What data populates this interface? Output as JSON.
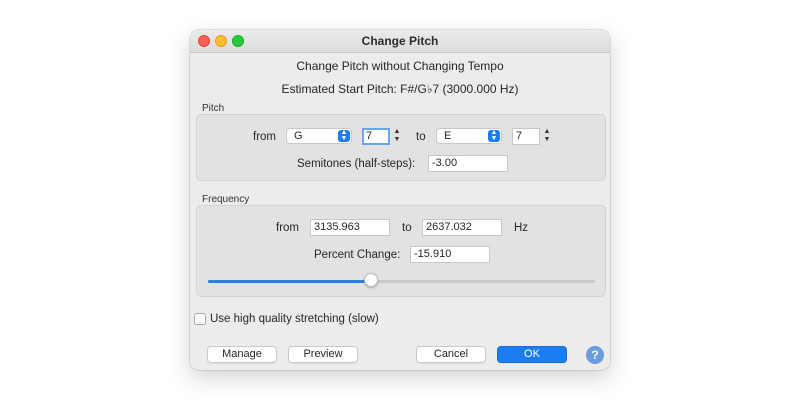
{
  "window": {
    "title": "Change Pitch"
  },
  "header": {
    "subtitle": "Change Pitch without Changing Tempo",
    "estimated_pitch": "Estimated Start Pitch: F#/G♭7 (3000.000 Hz)"
  },
  "pitch": {
    "section_label": "Pitch",
    "from_label": "from",
    "from_note": "G",
    "from_octave": "7",
    "to_label": "to",
    "to_note": "E",
    "to_octave": "7",
    "semitones_label": "Semitones (half-steps):",
    "semitones_value": "-3.00"
  },
  "frequency": {
    "section_label": "Frequency",
    "from_label": "from",
    "from_value": "3135.963",
    "to_label": "to",
    "to_value": "2637.032",
    "unit": "Hz",
    "percent_label": "Percent Change:",
    "percent_value": "-15.910",
    "slider_fraction": 0.42
  },
  "options": {
    "high_quality_label": "Use high quality stretching (slow)",
    "high_quality_checked": false
  },
  "buttons": {
    "manage": "Manage",
    "preview": "Preview",
    "cancel": "Cancel",
    "ok": "OK",
    "help": "?"
  },
  "colors": {
    "accent": "#1a7df2",
    "close": "#fe5f57",
    "minimize": "#febc2e",
    "maximize": "#28c840"
  },
  "icons": {
    "select_arrows": "up-down-chevron",
    "stepper": "up-down-stepper",
    "help": "question-mark"
  }
}
